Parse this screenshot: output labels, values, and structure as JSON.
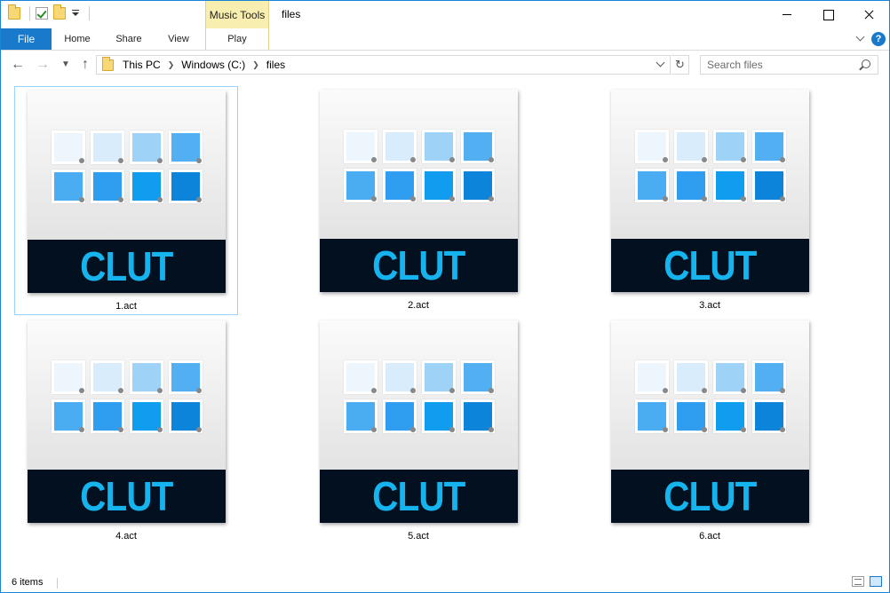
{
  "window": {
    "title": "files",
    "context_tab": "Music Tools"
  },
  "ribbon": {
    "tabs": [
      "File",
      "Home",
      "Share",
      "View",
      "Play"
    ],
    "help": "?"
  },
  "nav": {
    "breadcrumbs": [
      "This PC",
      "Windows (C:)",
      "files"
    ],
    "search_placeholder": "Search files"
  },
  "thumbnail": {
    "label": "CLUT",
    "swatch_colors": [
      "#eef6fd",
      "#d9ecfb",
      "#9fd2f7",
      "#52b0f2",
      "#4aacf1",
      "#2f9ef0",
      "#109cef",
      "#0b84d9"
    ]
  },
  "files": [
    {
      "name": "1.act",
      "selected": true
    },
    {
      "name": "2.act",
      "selected": false
    },
    {
      "name": "3.act",
      "selected": false
    },
    {
      "name": "4.act",
      "selected": false
    },
    {
      "name": "5.act",
      "selected": false
    },
    {
      "name": "6.act",
      "selected": false
    }
  ],
  "status": {
    "count": "6 items"
  },
  "colors": {
    "accent": "#1979ca",
    "context_tab_bg": "#f8eeb0",
    "thumb_band": "#03101f",
    "clut_text": "#16b4ee",
    "selection_border": "#99d1ff"
  }
}
